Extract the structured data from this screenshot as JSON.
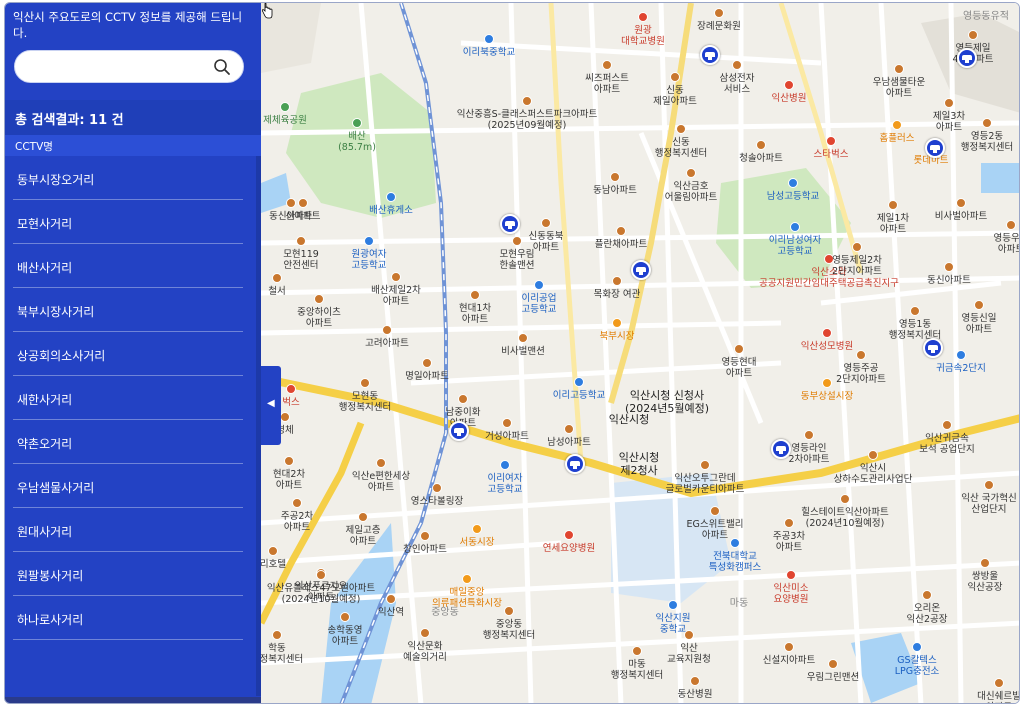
{
  "sidebar": {
    "intro": "익산시 주요도로의 CCTV 정보를 제공해 드립니다.",
    "search": {
      "value": "",
      "placeholder": ""
    },
    "result": "총 검색결과: 11 건",
    "column_header": "CCTV명",
    "items": [
      {
        "label": "동부시장오거리"
      },
      {
        "label": "모현사거리"
      },
      {
        "label": "배산사거리"
      },
      {
        "label": "북부시장사거리"
      },
      {
        "label": "상공회의소사거리"
      },
      {
        "label": "새한사거리"
      },
      {
        "label": "약촌오거리"
      },
      {
        "label": "우남샘물사거리"
      },
      {
        "label": "원대사거리"
      },
      {
        "label": "원팔봉사거리"
      },
      {
        "label": "하나로사거리"
      }
    ],
    "toggle_icon": "collapse-left-icon"
  },
  "map": {
    "colors": {
      "road_major": "#f5cf47",
      "road_minor": "#ffffff",
      "park": "#cfe8bf",
      "water": "#a9d3f5",
      "rail": "#6f93d6",
      "cctv": "#1e3fcf"
    },
    "labels": [
      {
        "text": "원광\n대학교병원",
        "color": "red"
      },
      {
        "text": "장례문화원",
        "color": "brown"
      },
      {
        "text": "영등동유적",
        "color": "gray"
      },
      {
        "text": "영등제일\n4차아파트",
        "color": "brown"
      },
      {
        "text": "이리북중학교",
        "color": "blue"
      },
      {
        "text": "삼성전자\n서비스",
        "color": "brown"
      },
      {
        "text": "씨즈퍼스트\n아파트",
        "color": "brown"
      },
      {
        "text": "신동\n제일아파트",
        "color": "brown"
      },
      {
        "text": "익산병원",
        "color": "red"
      },
      {
        "text": "우남샘물타운\n아파트",
        "color": "brown"
      },
      {
        "text": "익산중흥S-클래스퍼스트파크아파트\n(2025년09월예정)",
        "color": "brown"
      },
      {
        "text": "제일3차\n아파트",
        "color": "brown"
      },
      {
        "text": "영등2동\n행정복지센터",
        "color": "brown"
      },
      {
        "text": "배산\n(85.7m)",
        "color": "green"
      },
      {
        "text": "제체육공원",
        "color": "green"
      },
      {
        "text": "신동\n행정복지센터",
        "color": "brown"
      },
      {
        "text": "청솔아파트",
        "color": "brown"
      },
      {
        "text": "스타벅스",
        "color": "red"
      },
      {
        "text": "홈플러스",
        "color": "orange"
      },
      {
        "text": "롯데마트",
        "color": "orange"
      },
      {
        "text": "동남아파트",
        "color": "brown"
      },
      {
        "text": "익산금호\n어울림아파트",
        "color": "brown"
      },
      {
        "text": "남성고등학교",
        "color": "blue"
      },
      {
        "text": "배산휴게소",
        "color": "blue"
      },
      {
        "text": "동신아파트",
        "color": "brown"
      },
      {
        "text": "제일1차\n아파트",
        "color": "brown"
      },
      {
        "text": "비사벌아파트",
        "color": "brown"
      },
      {
        "text": "신동동북\n아파트",
        "color": "brown"
      },
      {
        "text": "플란채아파트",
        "color": "brown"
      },
      {
        "text": "이리남성여자\n고등학교",
        "color": "blue"
      },
      {
        "text": "영등우남\n아파트",
        "color": "brown"
      },
      {
        "text": "모현119\n안전센터",
        "color": "brown"
      },
      {
        "text": "원광여자\n고등학교",
        "color": "blue"
      },
      {
        "text": "모현우림\n한솔맨션",
        "color": "brown"
      },
      {
        "text": "익산소라\n공공지원민간임대주택공급촉진지구",
        "color": "red"
      },
      {
        "text": "영등제일2차\n2단지아파트",
        "color": "brown"
      },
      {
        "text": "동신아파트",
        "color": "brown"
      },
      {
        "text": "배산제일2차\n아파트",
        "color": "brown"
      },
      {
        "text": "이리공업\n고등학교",
        "color": "blue"
      },
      {
        "text": "목화장 여관",
        "color": "brown"
      },
      {
        "text": "철서",
        "color": "brown"
      },
      {
        "text": "중앙하이츠\n아파트",
        "color": "brown"
      },
      {
        "text": "현대1차\n아파트",
        "color": "brown"
      },
      {
        "text": "북부시장",
        "color": "orange"
      },
      {
        "text": "영등1동\n행정복지센터",
        "color": "brown"
      },
      {
        "text": "영등신일\n아파트",
        "color": "brown"
      },
      {
        "text": "고려아파트",
        "color": "brown"
      },
      {
        "text": "익산성모병원",
        "color": "red"
      },
      {
        "text": "비사벌맨션",
        "color": "brown"
      },
      {
        "text": "영등현대\n아파트",
        "color": "brown"
      },
      {
        "text": "영등주공\n2단지아파트",
        "color": "brown"
      },
      {
        "text": "귀금속2단지",
        "color": "blue"
      },
      {
        "text": "명일아파트",
        "color": "brown"
      },
      {
        "text": "이리고등학교",
        "color": "blue"
      },
      {
        "text": "익산시청 신청사\n(2024년5월예정)",
        "color": "big"
      },
      {
        "text": "동부상설시장",
        "color": "orange"
      },
      {
        "text": "모현동\n행정복지센터",
        "color": "brown"
      },
      {
        "text": "남중이화\n아파트",
        "color": "brown"
      },
      {
        "text": "익산시청",
        "color": "big"
      },
      {
        "text": "영등라인\n2차아파트",
        "color": "brown"
      },
      {
        "text": "익산귀금속\n보석 공업단지",
        "color": "brown"
      },
      {
        "text": "거성아파트",
        "color": "brown"
      },
      {
        "text": "남성아파트",
        "color": "brown"
      },
      {
        "text": "익산시청\n제2청사",
        "color": "big"
      },
      {
        "text": "익산시\n상하수도관리사업단",
        "color": "brown"
      },
      {
        "text": "현대2차\n아파트",
        "color": "brown"
      },
      {
        "text": "익산e편한세상\n아파트",
        "color": "brown"
      },
      {
        "text": "이리여자\n고등학교",
        "color": "blue"
      },
      {
        "text": "익산오투그란데\n글로벌카운티아파트",
        "color": "brown"
      },
      {
        "text": "익산 국가혁신\n산업단지",
        "color": "brown"
      },
      {
        "text": "영스타볼링장",
        "color": "brown"
      },
      {
        "text": "힐스테이트익산아파트\n(2024년10월예정)",
        "color": "brown"
      },
      {
        "text": "주공2차\n아파트",
        "color": "brown"
      },
      {
        "text": "제일고층\n아파트",
        "color": "brown"
      },
      {
        "text": "EG스위트밸리\n아파트",
        "color": "brown"
      },
      {
        "text": "서동시장",
        "color": "orange"
      },
      {
        "text": "연세요양병원",
        "color": "red"
      },
      {
        "text": "주공3차\n아파트",
        "color": "brown"
      },
      {
        "text": "창인아파트",
        "color": "brown"
      },
      {
        "text": "전북대학교\n특성화캠퍼스",
        "color": "blue"
      },
      {
        "text": "리호텔",
        "color": "brown"
      },
      {
        "text": "익산푸르지오\n아파트",
        "color": "brown"
      },
      {
        "text": "익산유블레스47모현아파트\n(2024년10월예정)",
        "color": "brown"
      },
      {
        "text": "매일중앙\n의류패션특화시장",
        "color": "orange"
      },
      {
        "text": "익산미소\n요양병원",
        "color": "red"
      },
      {
        "text": "쌍방울\n익산공장",
        "color": "brown"
      },
      {
        "text": "익산역",
        "color": "brown"
      },
      {
        "text": "중앙동",
        "color": "gray"
      },
      {
        "text": "익산지원\n중학교",
        "color": "blue"
      },
      {
        "text": "마동",
        "color": "gray"
      },
      {
        "text": "오리온\n익산2공장",
        "color": "brown"
      },
      {
        "text": "송학동영\n아파트",
        "color": "brown"
      },
      {
        "text": "중앙동\n행정복지센터",
        "color": "brown"
      },
      {
        "text": "익산\n교육지원청",
        "color": "brown"
      },
      {
        "text": "학동\n행정복지센터",
        "color": "brown"
      },
      {
        "text": "익산문화\n예술의거리",
        "color": "brown"
      },
      {
        "text": "마동\n행정복지센터",
        "color": "brown"
      },
      {
        "text": "신설지아파트",
        "color": "brown"
      },
      {
        "text": "GS칼텍스\nLPG충전소",
        "color": "blue"
      },
      {
        "text": "우림그린맨션",
        "color": "brown"
      },
      {
        "text": "동산병원",
        "color": "brown"
      },
      {
        "text": "대신쉐르빌\n아파트",
        "color": "brown"
      },
      {
        "text": "신아파트",
        "color": "brown"
      },
      {
        "text": "경체",
        "color": "brown"
      },
      {
        "text": "벅스",
        "color": "red"
      }
    ],
    "cctv_markers": [
      {
        "name": "cctv-marker-1",
        "icon": "cctv-icon"
      },
      {
        "name": "cctv-marker-2",
        "icon": "cctv-icon"
      },
      {
        "name": "cctv-marker-3",
        "icon": "cctv-icon"
      },
      {
        "name": "cctv-marker-4",
        "icon": "cctv-icon"
      },
      {
        "name": "cctv-marker-5",
        "icon": "cctv-icon"
      },
      {
        "name": "cctv-marker-6",
        "icon": "cctv-icon"
      },
      {
        "name": "cctv-marker-7",
        "icon": "cctv-icon"
      },
      {
        "name": "cctv-marker-8",
        "icon": "cctv-icon"
      },
      {
        "name": "cctv-marker-9",
        "icon": "cctv-icon"
      }
    ]
  }
}
